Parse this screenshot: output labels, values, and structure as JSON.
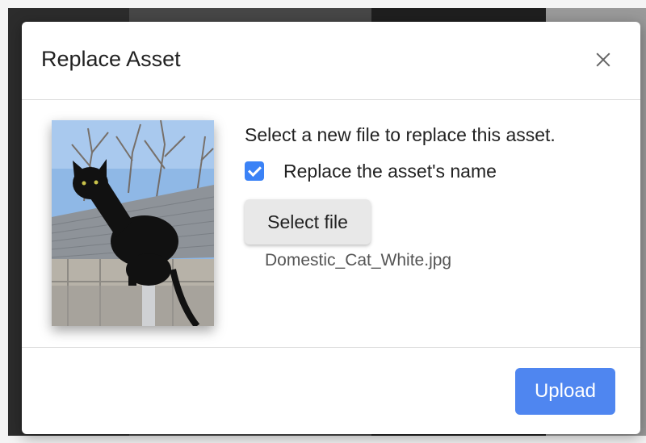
{
  "modal": {
    "title": "Replace Asset",
    "close_icon": "close-icon",
    "instructions": "Select a new file to replace this asset.",
    "replace_name": {
      "checked": true,
      "label": "Replace the asset's name"
    },
    "select_file_label": "Select file",
    "selected_file_name": "Domestic_Cat_White.jpg",
    "upload_label": "Upload",
    "thumbnail": "black cat sitting on a fence post"
  },
  "colors": {
    "accent": "#4f86f0",
    "checkbox": "#3b82f6"
  }
}
